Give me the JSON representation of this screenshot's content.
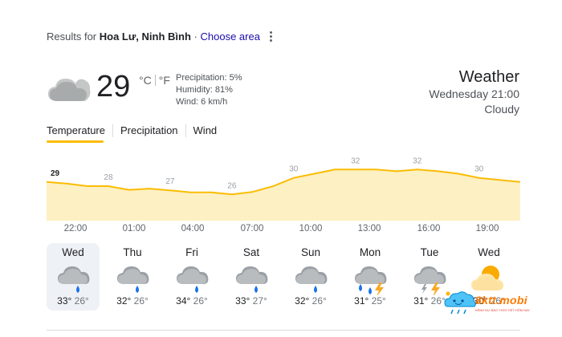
{
  "header": {
    "prefix": "Results for",
    "location": "Hoa Lư, Ninh Bình",
    "separator": "·",
    "choose_area": "Choose area"
  },
  "current": {
    "icon": "cloud-icon",
    "temperature": "29",
    "unit_c": "°C",
    "unit_f": "°F",
    "precipitation": "Precipitation: 5%",
    "humidity": "Humidity: 81%",
    "wind": "Wind: 6 km/h"
  },
  "summary": {
    "title": "Weather",
    "datetime": "Wednesday 21:00",
    "condition": "Cloudy"
  },
  "tabs": [
    "Temperature",
    "Precipitation",
    "Wind"
  ],
  "active_tab": "Temperature",
  "chart_data": {
    "type": "area",
    "x": [
      "22:00",
      "23:00",
      "00:00",
      "01:00",
      "02:00",
      "03:00",
      "04:00",
      "05:00",
      "06:00",
      "07:00",
      "08:00",
      "09:00",
      "10:00",
      "11:00",
      "12:00",
      "13:00",
      "14:00",
      "15:00",
      "16:00",
      "17:00",
      "18:00",
      "19:00",
      "20:00",
      "21:00"
    ],
    "values": [
      29,
      28.6,
      28,
      28,
      27.1,
      27.4,
      27,
      26.5,
      26.5,
      26,
      26.6,
      28,
      30,
      31,
      32,
      32,
      32,
      31.6,
      32,
      31.6,
      31,
      30,
      29.5,
      29
    ],
    "labels": [
      {
        "x": "22:00",
        "value": "29"
      },
      {
        "x": "01:00",
        "value": "28"
      },
      {
        "x": "04:00",
        "value": "27"
      },
      {
        "x": "07:00",
        "value": "26"
      },
      {
        "x": "10:00",
        "value": "30"
      },
      {
        "x": "13:00",
        "value": "32"
      },
      {
        "x": "16:00",
        "value": "32"
      },
      {
        "x": "19:00",
        "value": "30"
      }
    ],
    "time_ticks": [
      "22:00",
      "01:00",
      "04:00",
      "07:00",
      "10:00",
      "13:00",
      "16:00",
      "19:00"
    ],
    "ylim": [
      22,
      34
    ],
    "line_color": "#fbbc04",
    "fill_color": "#fdf0c2",
    "grid": false
  },
  "forecast": [
    {
      "day": "Wed",
      "icon": "cloud-rain-icon",
      "high": "33°",
      "low": "26°"
    },
    {
      "day": "Thu",
      "icon": "cloud-rain-icon",
      "high": "32°",
      "low": "26°"
    },
    {
      "day": "Fri",
      "icon": "cloud-rain-icon",
      "high": "34°",
      "low": "26°"
    },
    {
      "day": "Sat",
      "icon": "cloud-rain-icon",
      "high": "33°",
      "low": "27°"
    },
    {
      "day": "Sun",
      "icon": "cloud-rain-icon",
      "high": "32°",
      "low": "26°"
    },
    {
      "day": "Mon",
      "icon": "thunderstorm-rain-icon",
      "high": "31°",
      "low": "25°"
    },
    {
      "day": "Tue",
      "icon": "thunderstorm-icon",
      "high": "31°",
      "low": "26°"
    },
    {
      "day": "Wed",
      "icon": "partly-sunny-icon",
      "high": "30°",
      "low": "26°"
    }
  ],
  "selected_day": "Wed",
  "watermark": {
    "name": "8ktt.mobi",
    "tagline": "KÊNH DỰ BÁO THỜI TIẾT HÔM NAY"
  },
  "colors": {
    "accent": "#fbbc04",
    "link": "#1a0dab",
    "rain": "#1a73e8",
    "bolt": "#f9a825",
    "sun": "#f9ab00"
  }
}
